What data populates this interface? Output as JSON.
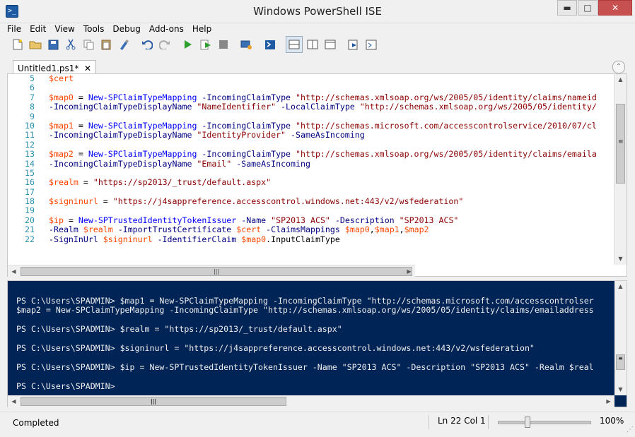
{
  "window": {
    "title": "Windows PowerShell ISE",
    "app_icon": "ps-icon",
    "controls": {
      "minimize": "▬",
      "maximize": "□",
      "close": "✕"
    }
  },
  "menubar": {
    "items": [
      {
        "label": "File"
      },
      {
        "label": "Edit"
      },
      {
        "label": "View"
      },
      {
        "label": "Tools"
      },
      {
        "label": "Debug"
      },
      {
        "label": "Add-ons"
      },
      {
        "label": "Help"
      }
    ]
  },
  "toolbar": {
    "icons": [
      "new-file-icon",
      "open-folder-icon",
      "save-icon",
      "cut-icon",
      "copy-icon",
      "paste-icon",
      "clear-console-icon",
      "undo-icon",
      "redo-icon",
      "run-script-icon",
      "run-selection-icon",
      "stop-icon",
      "remote-powershell-icon",
      "start-powershell-icon",
      "show-script-top-icon",
      "show-script-right-icon",
      "show-script-maximized-icon",
      "show-script-pane-icon",
      "show-command-addon-icon"
    ]
  },
  "tabs": [
    {
      "label": "Untitled1.ps1*",
      "close": "✕"
    }
  ],
  "editor": {
    "lines": [
      {
        "num": "5",
        "tokens": [
          {
            "t": "$cert",
            "c": "var"
          }
        ]
      },
      {
        "num": "6",
        "tokens": []
      },
      {
        "num": "7",
        "tokens": [
          {
            "t": "$map0",
            "c": "var"
          },
          {
            "t": " = ",
            "c": "plain"
          },
          {
            "t": "New-SPClaimTypeMapping",
            "c": "cmd"
          },
          {
            "t": " -IncomingClaimType",
            "c": "prm"
          },
          {
            "t": " \"http://schemas.xmlsoap.org/ws/2005/05/identity/claims/nameid",
            "c": "str"
          }
        ]
      },
      {
        "num": "8",
        "tokens": [
          {
            "t": "-IncomingClaimTypeDisplayName",
            "c": "prm"
          },
          {
            "t": " \"NameIdentifier\"",
            "c": "str"
          },
          {
            "t": " -LocalClaimType",
            "c": "prm"
          },
          {
            "t": " \"http://schemas.xmlsoap.org/ws/2005/05/identity/",
            "c": "str"
          }
        ]
      },
      {
        "num": "9",
        "tokens": []
      },
      {
        "num": "10",
        "tokens": [
          {
            "t": "$map1",
            "c": "var"
          },
          {
            "t": " = ",
            "c": "plain"
          },
          {
            "t": "New-SPClaimTypeMapping",
            "c": "cmd"
          },
          {
            "t": " -IncomingClaimType",
            "c": "prm"
          },
          {
            "t": " \"http://schemas.microsoft.com/accesscontrolservice/2010/07/cl",
            "c": "str"
          }
        ]
      },
      {
        "num": "11",
        "tokens": [
          {
            "t": "-IncomingClaimTypeDisplayName",
            "c": "prm"
          },
          {
            "t": " \"IdentityProvider\"",
            "c": "str"
          },
          {
            "t": " -SameAsIncoming",
            "c": "prm"
          }
        ]
      },
      {
        "num": "12",
        "tokens": []
      },
      {
        "num": "13",
        "tokens": [
          {
            "t": "$map2",
            "c": "var"
          },
          {
            "t": " = ",
            "c": "plain"
          },
          {
            "t": "New-SPClaimTypeMapping",
            "c": "cmd"
          },
          {
            "t": " -IncomingClaimType",
            "c": "prm"
          },
          {
            "t": " \"http://schemas.xmlsoap.org/ws/2005/05/identity/claims/emaila",
            "c": "str"
          }
        ]
      },
      {
        "num": "14",
        "tokens": [
          {
            "t": "-IncomingClaimTypeDisplayName",
            "c": "prm"
          },
          {
            "t": " \"Email\"",
            "c": "str"
          },
          {
            "t": " -SameAsIncoming",
            "c": "prm"
          }
        ]
      },
      {
        "num": "15",
        "tokens": []
      },
      {
        "num": "16",
        "tokens": [
          {
            "t": "$realm",
            "c": "var"
          },
          {
            "t": " = ",
            "c": "plain"
          },
          {
            "t": "\"https://sp2013/_trust/default.aspx\"",
            "c": "str"
          }
        ]
      },
      {
        "num": "17",
        "tokens": []
      },
      {
        "num": "18",
        "tokens": [
          {
            "t": "$signinurl",
            "c": "var"
          },
          {
            "t": " = ",
            "c": "plain"
          },
          {
            "t": "\"https://j4sappreference.accesscontrol.windows.net:443/v2/wsfederation\"",
            "c": "str"
          }
        ]
      },
      {
        "num": "19",
        "tokens": []
      },
      {
        "num": "20",
        "tokens": [
          {
            "t": "$ip",
            "c": "var"
          },
          {
            "t": " = ",
            "c": "plain"
          },
          {
            "t": "New-SPTrustedIdentityTokenIssuer",
            "c": "cmd"
          },
          {
            "t": " -Name",
            "c": "prm"
          },
          {
            "t": " \"SP2013 ACS\"",
            "c": "str"
          },
          {
            "t": " -Description",
            "c": "prm"
          },
          {
            "t": " \"SP2013 ACS\"",
            "c": "str"
          }
        ]
      },
      {
        "num": "21",
        "tokens": [
          {
            "t": "-Realm",
            "c": "prm"
          },
          {
            "t": " $realm",
            "c": "var"
          },
          {
            "t": " -ImportTrustCertificate",
            "c": "prm"
          },
          {
            "t": " $cert",
            "c": "var"
          },
          {
            "t": " -ClaimsMappings",
            "c": "prm"
          },
          {
            "t": " $map0",
            "c": "var"
          },
          {
            "t": ",",
            "c": "plain"
          },
          {
            "t": "$map1",
            "c": "var"
          },
          {
            "t": ",",
            "c": "plain"
          },
          {
            "t": "$map2",
            "c": "var"
          }
        ]
      },
      {
        "num": "22",
        "tokens": [
          {
            "t": "-SignInUrl",
            "c": "prm"
          },
          {
            "t": " $signinurl",
            "c": "var"
          },
          {
            "t": " -IdentifierClaim",
            "c": "prm"
          },
          {
            "t": " $map0",
            "c": "var"
          },
          {
            "t": ".InputClaimType",
            "c": "plain"
          }
        ]
      }
    ],
    "scrollbar_grip": "≡",
    "hscroll_grip": "|||"
  },
  "console": {
    "lines": [
      "PS C:\\Users\\SPADMIN> $map1 = New-SPClaimTypeMapping -IncomingClaimType \"http://schemas.microsoft.com/accesscontrolser",
      "$map2 = New-SPClaimTypeMapping -IncomingClaimType \"http://schemas.xmlsoap.org/ws/2005/05/identity/claims/emailaddress",
      "",
      "PS C:\\Users\\SPADMIN> $realm = \"https://sp2013/_trust/default.aspx\"",
      "",
      "PS C:\\Users\\SPADMIN> $signinurl = \"https://j4sappreference.accesscontrol.windows.net:443/v2/wsfederation\"",
      "",
      "PS C:\\Users\\SPADMIN> $ip = New-SPTrustedIdentityTokenIssuer -Name \"SP2013 ACS\" -Description \"SP2013 ACS\" -Realm $real",
      "",
      "PS C:\\Users\\SPADMIN>"
    ],
    "hscroll_grip": "|||",
    "vscroll_grip": "≡"
  },
  "status": {
    "text": "Completed",
    "line_col": "Ln 22  Col 1",
    "zoom": "100%",
    "zoom_level": 0.3
  },
  "colors": {
    "variable": "#ff4500",
    "cmdlet": "#0000ff",
    "parameter": "#000080",
    "string": "#8b0000",
    "console_bg": "#012456"
  }
}
